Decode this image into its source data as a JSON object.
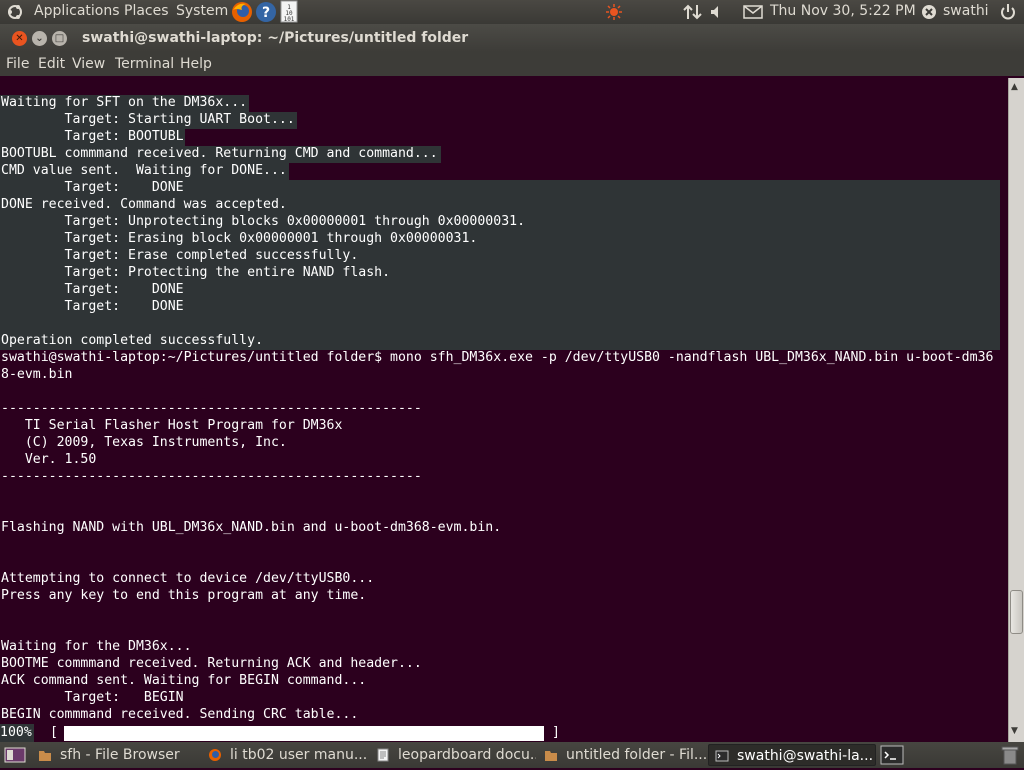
{
  "top_panel": {
    "menus": [
      "Applications",
      "Places",
      "System"
    ],
    "clock": "Thu Nov 30,  5:22 PM",
    "user": "swathi"
  },
  "window": {
    "title": "swathi@swathi-laptop: ~/Pictures/untitled folder",
    "menu": [
      "File",
      "Edit",
      "View",
      "Terminal",
      "Help"
    ]
  },
  "terminal": {
    "lines": [
      "Waiting for SFT on the DM36x...",
      "        Target: Starting UART Boot...",
      "        Target: BOOTUBL",
      "BOOTUBL commmand received. Returning CMD and command...",
      "CMD value sent.  Waiting for DONE...",
      "        Target:    DONE",
      "DONE received. Command was accepted.",
      "        Target: Unprotecting blocks 0x00000001 through 0x00000031.",
      "        Target: Erasing block 0x00000001 through 0x00000031.",
      "        Target: Erase completed successfully.",
      "        Target: Protecting the entire NAND flash.",
      "        Target:    DONE",
      "        Target:    DONE",
      "",
      "Operation completed successfully.",
      "swathi@swathi-laptop:~/Pictures/untitled folder$ mono sfh_DM36x.exe -p /dev/ttyUSB0 -nandflash UBL_DM36x_NAND.bin u-boot-dm36",
      "8-evm.bin",
      "",
      "-----------------------------------------------------",
      "   TI Serial Flasher Host Program for DM36x",
      "   (C) 2009, Texas Instruments, Inc.",
      "   Ver. 1.50",
      "-----------------------------------------------------",
      "",
      "",
      "Flashing NAND with UBL_DM36x_NAND.bin and u-boot-dm368-evm.bin.",
      "",
      "",
      "Attempting to connect to device /dev/ttyUSB0...",
      "Press any key to end this program at any time.",
      "",
      "",
      "Waiting for the DM36x...",
      "BOOTME commmand received. Returning ACK and header...",
      "ACK command sent. Waiting for BEGIN command...",
      "        Target:   BEGIN",
      "BEGIN commmand received. Sending CRC table..."
    ],
    "progress": {
      "label": " 100%",
      "open_bracket": "[",
      "close_bracket": "]",
      "fraction": 1.0
    }
  },
  "taskbar": {
    "tasks": [
      {
        "label": "sfh - File Browser",
        "icon": "folder-icon"
      },
      {
        "label": "li tb02 user manu...",
        "icon": "firefox-icon"
      },
      {
        "label": "leopardboard docu...",
        "icon": "document-icon"
      },
      {
        "label": "untitled folder - Fil...",
        "icon": "folder-icon"
      },
      {
        "label": "swathi@swathi-la...",
        "icon": "terminal-icon"
      }
    ]
  },
  "colors": {
    "terminal_bg": "#2c001e",
    "selection_bg": "#2f3436",
    "panel_bg": "#3c3b37",
    "close_button": "#e95420"
  }
}
